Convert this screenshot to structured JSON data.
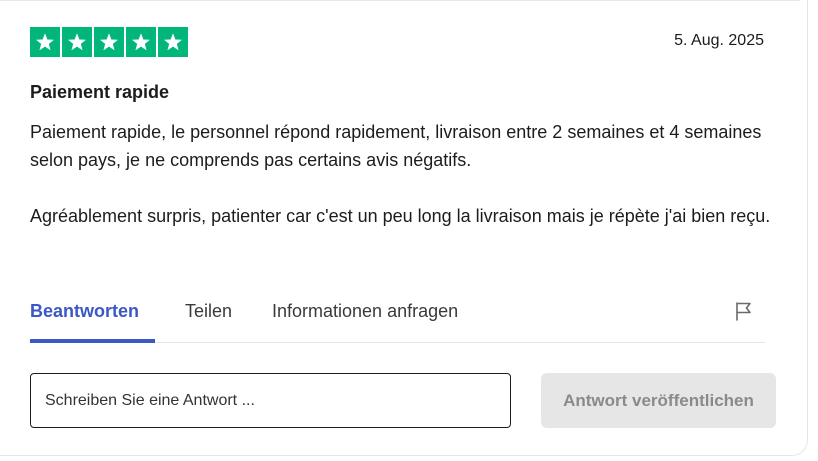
{
  "review": {
    "rating": 5,
    "rating_max": 5,
    "star_color": "#00b67a",
    "date": "5. Aug. 2025",
    "title": "Paiement rapide",
    "paragraphs": [
      "Paiement rapide, le personnel répond rapidement, livraison entre 2 semaines et 4 semaines selon pays, je ne comprends pas certains avis négatifs.",
      "Agréablement surpris, patienter car c'est un peu long la livraison mais je répète j'ai bien reçu."
    ]
  },
  "tabs": {
    "reply": "Beantworten",
    "share": "Teilen",
    "info": "Informationen anfragen",
    "active": "reply",
    "accent_color": "#3b58c4",
    "report_icon": "flag-icon"
  },
  "reply_form": {
    "input_value": "",
    "input_placeholder": "Schreiben Sie eine Antwort ...",
    "publish_label": "Antwort veröffentlichen"
  }
}
